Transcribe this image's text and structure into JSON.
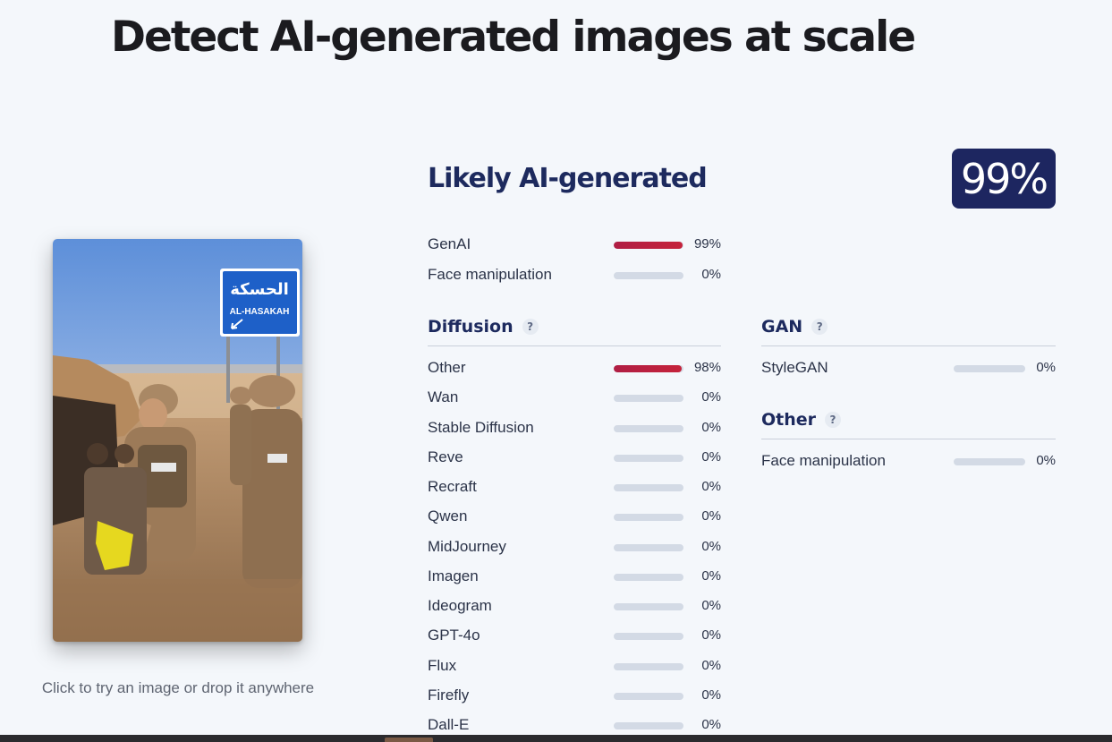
{
  "headline": "Detect AI-generated images at scale",
  "upload": {
    "hint": "Click to try an image or drop it anywhere",
    "sign_arabic": "الحسكة",
    "sign_latin": "AL-HASAKAH"
  },
  "result": {
    "verdict": "Likely AI-generated",
    "score": "99%",
    "summary": [
      {
        "label": "GenAI",
        "value": 0.99,
        "pct": "99%"
      },
      {
        "label": "Face manipulation",
        "value": 0.0,
        "pct": "0%"
      }
    ]
  },
  "sections": {
    "diffusion": {
      "title": "Diffusion",
      "help": "?",
      "items": [
        {
          "label": "Other",
          "value": 0.98,
          "pct": "98%"
        },
        {
          "label": "Wan",
          "value": 0.0,
          "pct": "0%"
        },
        {
          "label": "Stable Diffusion",
          "value": 0.0,
          "pct": "0%"
        },
        {
          "label": "Reve",
          "value": 0.0,
          "pct": "0%"
        },
        {
          "label": "Recraft",
          "value": 0.0,
          "pct": "0%"
        },
        {
          "label": "Qwen",
          "value": 0.0,
          "pct": "0%"
        },
        {
          "label": "MidJourney",
          "value": 0.0,
          "pct": "0%"
        },
        {
          "label": "Imagen",
          "value": 0.0,
          "pct": "0%"
        },
        {
          "label": "Ideogram",
          "value": 0.0,
          "pct": "0%"
        },
        {
          "label": "GPT-4o",
          "value": 0.0,
          "pct": "0%"
        },
        {
          "label": "Flux",
          "value": 0.0,
          "pct": "0%"
        },
        {
          "label": "Firefly",
          "value": 0.0,
          "pct": "0%"
        },
        {
          "label": "Dall-E",
          "value": 0.0,
          "pct": "0%"
        }
      ]
    },
    "gan": {
      "title": "GAN",
      "help": "?",
      "items": [
        {
          "label": "StyleGAN",
          "value": 0.0,
          "pct": "0%"
        }
      ]
    },
    "other": {
      "title": "Other",
      "help": "?",
      "items": [
        {
          "label": "Face manipulation",
          "value": 0.0,
          "pct": "0%"
        }
      ]
    }
  },
  "colors": {
    "background": "#f4f7fb",
    "accent_navy": "#1d2660",
    "bar_fill": "#c5233b",
    "bar_track": "#d3dae5"
  }
}
